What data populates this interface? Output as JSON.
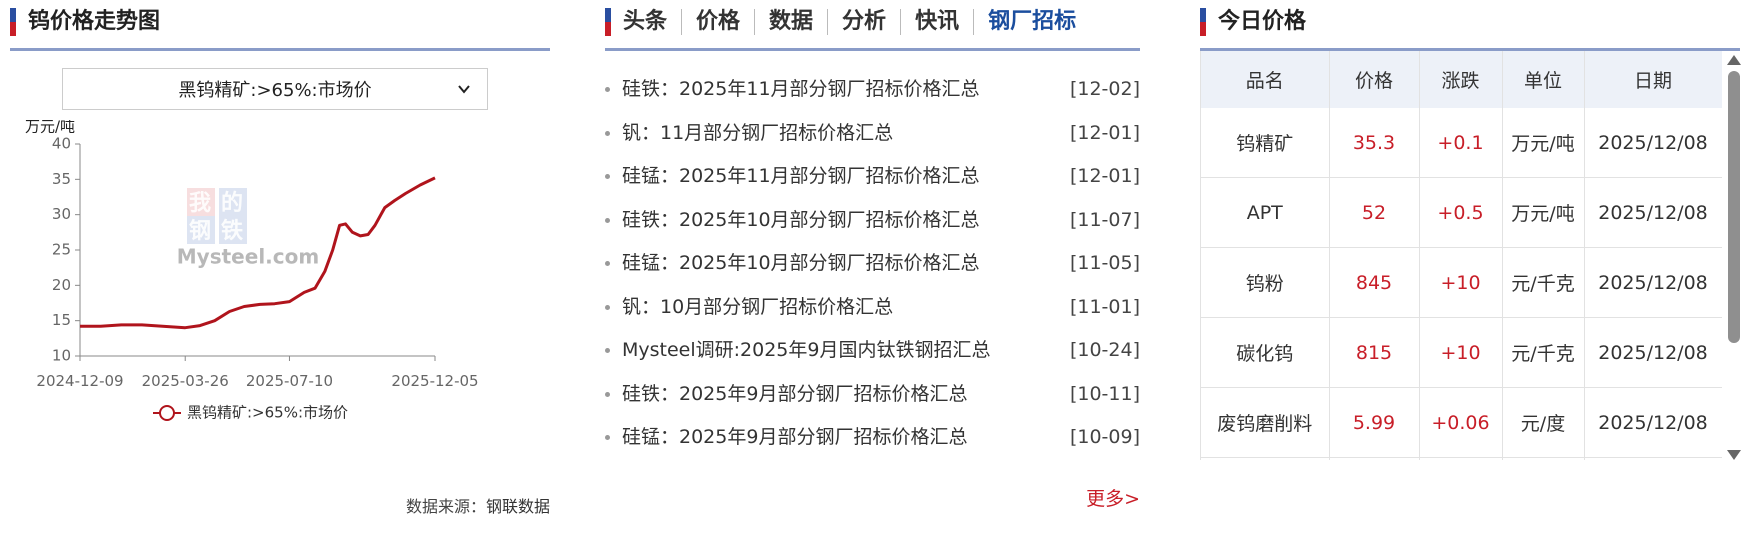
{
  "left_panel": {
    "title": "钨价格走势图",
    "select_value": "黑钨精矿:>65%:市场价",
    "source_label": "数据来源：",
    "source_value": "钢联数据"
  },
  "chart_data": {
    "type": "line",
    "ylabel": "万元/吨",
    "ylim": [
      10,
      40
    ],
    "yticks": [
      10,
      15,
      20,
      25,
      30,
      35,
      40
    ],
    "xticks": [
      "2024-12-09",
      "2025-03-26",
      "2025-07-10",
      "2025-12-05"
    ],
    "watermark": [
      "我",
      "的",
      "钢",
      "铁",
      "Mysteel.com"
    ],
    "color": "#b0141c",
    "series": [
      {
        "name": "黑钨精矿:>65%:市场价",
        "points": [
          [
            "2024-12-09",
            14.2
          ],
          [
            "2024-12-30",
            14.2
          ],
          [
            "2025-01-20",
            14.4
          ],
          [
            "2025-02-10",
            14.4
          ],
          [
            "2025-03-03",
            14.2
          ],
          [
            "2025-03-26",
            14.0
          ],
          [
            "2025-04-10",
            14.3
          ],
          [
            "2025-04-25",
            15.0
          ],
          [
            "2025-05-10",
            16.3
          ],
          [
            "2025-05-25",
            17.0
          ],
          [
            "2025-06-10",
            17.3
          ],
          [
            "2025-06-25",
            17.4
          ],
          [
            "2025-07-10",
            17.7
          ],
          [
            "2025-07-25",
            19.0
          ],
          [
            "2025-08-05",
            19.6
          ],
          [
            "2025-08-15",
            22.0
          ],
          [
            "2025-08-23",
            25.0
          ],
          [
            "2025-08-30",
            28.5
          ],
          [
            "2025-09-05",
            28.7
          ],
          [
            "2025-09-12",
            27.5
          ],
          [
            "2025-09-20",
            27.0
          ],
          [
            "2025-09-28",
            27.2
          ],
          [
            "2025-10-05",
            28.5
          ],
          [
            "2025-10-15",
            31.0
          ],
          [
            "2025-10-25",
            32.0
          ],
          [
            "2025-11-05",
            33.0
          ],
          [
            "2025-11-20",
            34.2
          ],
          [
            "2025-12-05",
            35.2
          ]
        ]
      }
    ]
  },
  "middle_panel": {
    "tabs": [
      {
        "label": "头条",
        "active": false
      },
      {
        "label": "价格",
        "active": false
      },
      {
        "label": "数据",
        "active": false
      },
      {
        "label": "分析",
        "active": false
      },
      {
        "label": "快讯",
        "active": false
      },
      {
        "label": "钢厂招标",
        "active": true
      }
    ],
    "news": [
      {
        "title": "硅铁：2025年11月部分钢厂招标价格汇总",
        "date": "[12-02]"
      },
      {
        "title": "钒：11月部分钢厂招标价格汇总",
        "date": "[12-01]"
      },
      {
        "title": "硅锰：2025年11月部分钢厂招标价格汇总",
        "date": "[12-01]"
      },
      {
        "title": "硅铁：2025年10月部分钢厂招标价格汇总",
        "date": "[11-07]"
      },
      {
        "title": "硅锰：2025年10月部分钢厂招标价格汇总",
        "date": "[11-05]"
      },
      {
        "title": "钒：10月部分钢厂招标价格汇总",
        "date": "[11-01]"
      },
      {
        "title": "Mysteel调研:2025年9月国内钛铁钢招汇总",
        "date": "[10-24]"
      },
      {
        "title": "硅铁：2025年9月部分钢厂招标价格汇总",
        "date": "[10-11]"
      },
      {
        "title": "硅锰：2025年9月部分钢厂招标价格汇总",
        "date": "[10-09]"
      }
    ],
    "more": "更多>"
  },
  "right_panel": {
    "title": "今日价格",
    "columns": [
      "品名",
      "价格",
      "涨跌",
      "单位",
      "日期"
    ],
    "rows": [
      [
        "钨精矿",
        "35.3",
        "+0.1",
        "万元/吨",
        "2025/12/08"
      ],
      [
        "APT",
        "52",
        "+0.5",
        "万元/吨",
        "2025/12/08"
      ],
      [
        "钨粉",
        "845",
        "+10",
        "元/千克",
        "2025/12/08"
      ],
      [
        "碳化钨",
        "815",
        "+10",
        "元/千克",
        "2025/12/08"
      ],
      [
        "废钨磨削料",
        "5.99",
        "+0.06",
        "元/度",
        "2025/12/08"
      ],
      [
        "",
        "",
        "",
        "",
        ""
      ]
    ]
  }
}
